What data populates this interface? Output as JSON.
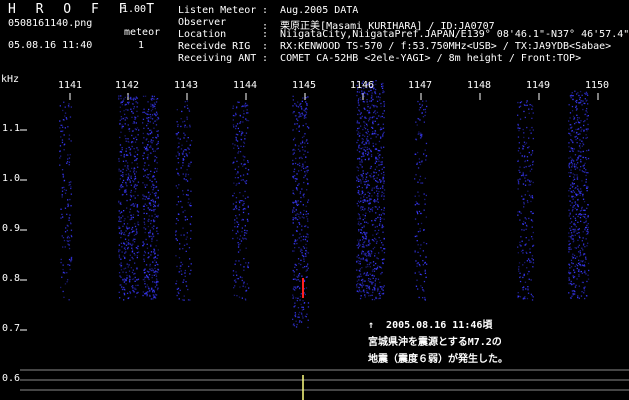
{
  "app": {
    "title": "H R O F F T",
    "version": "1.00"
  },
  "file": {
    "name": "0508161140.png",
    "datetime": "05.08.16 11:40"
  },
  "meteor": {
    "label": "meteor",
    "count": "1"
  },
  "info": [
    {
      "label": "Listen Meteor",
      "value": ":  Aug.2005 DATA"
    },
    {
      "label": "Observer",
      "value": ":  栗原正美[Masami KURIHARA] / ID:JA0707"
    },
    {
      "label": "Location",
      "value": ":  NiigataCity,NiigataPref.JAPAN/E139° 08'46.1\"-N37° 46'57.4\""
    },
    {
      "label": "Receivde RIG",
      "value": ":  RX:KENWOOD TS-570 / f:53.750MHz<USB> / TX:JA9YDB<Sabae>"
    },
    {
      "label": "Receiving ANT",
      "value": ":  COMET CA-52HB <2ele-YAGI> / 8m height / Front:TOP>"
    }
  ],
  "axis": {
    "y_unit": "kHz",
    "y_ticks": [
      "1.1",
      "1.0",
      "0.9",
      "0.8",
      "0.7",
      "0.6"
    ],
    "x_ticks": [
      "1141",
      "1142",
      "1143",
      "1144",
      "1145",
      "1146",
      "1147",
      "1148",
      "1149",
      "1150"
    ]
  },
  "annotation": {
    "line1": "↑  2005.08.16 11:46頃",
    "line2": "宮城県沖を震源とするM7.2の",
    "line3": "地震（震度６弱）が発生した。"
  },
  "colors": {
    "background": "#000000",
    "signal": "#3a3aff",
    "text": "#ffffff",
    "marker": "#ff2020"
  }
}
